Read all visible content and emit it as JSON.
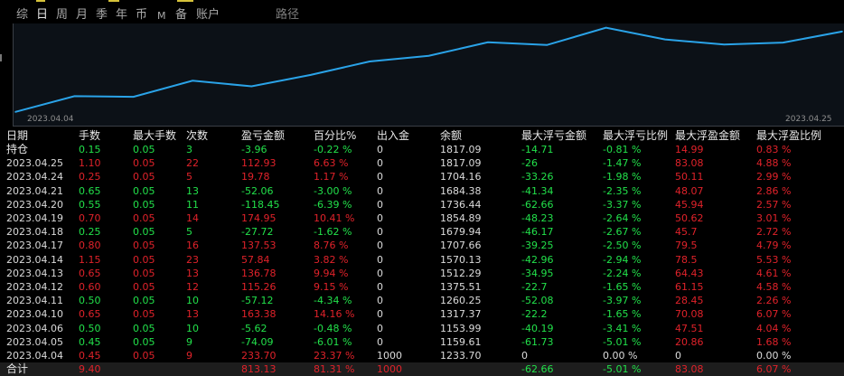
{
  "tabs": [
    {
      "label": "综",
      "active": false
    },
    {
      "label": "日",
      "active": true
    },
    {
      "label": "周",
      "active": false
    },
    {
      "label": "月",
      "active": false
    },
    {
      "label": "季",
      "active": false
    },
    {
      "label": "年",
      "active": false
    },
    {
      "label": "币",
      "active": false
    },
    {
      "label": "M",
      "active": false
    },
    {
      "label": "备",
      "active": false
    },
    {
      "label": "账户",
      "active": false
    }
  ],
  "path_label": "路径",
  "colors": {
    "line": "#2aa3e8",
    "positive": "#22e04a",
    "negative": "#e0222a",
    "text": "#dcdcdc"
  },
  "chart_data": {
    "type": "line",
    "x_start": "2023.04.04",
    "x_end": "2023.04.25",
    "x": [
      "2023.04.04",
      "2023.04.05",
      "2023.04.06",
      "2023.04.10",
      "2023.04.11",
      "2023.04.12",
      "2023.04.13",
      "2023.04.14",
      "2023.04.17",
      "2023.04.18",
      "2023.04.19",
      "2023.04.20",
      "2023.04.21",
      "2023.04.24",
      "2023.04.25"
    ],
    "values": [
      1000,
      1159.61,
      1153.99,
      1317.37,
      1260.25,
      1375.51,
      1512.29,
      1570.13,
      1707.66,
      1679.94,
      1854.89,
      1736.44,
      1684.38,
      1704.16,
      1817.09
    ],
    "ylim": [
      980,
      1880
    ]
  },
  "table": {
    "headers": [
      "日期",
      "手数",
      "最大手数",
      "次数",
      "盈亏金额",
      "百分比%",
      "出入金",
      "余额",
      "最大浮亏金额",
      "最大浮亏比例",
      "最大浮盈金额",
      "最大浮盈比例"
    ],
    "rows": [
      [
        "持仓",
        "0.15",
        "0.05",
        "3",
        "-3.96",
        "-0.22 %",
        "0",
        "1817.09",
        "-14.71",
        "-0.81 %",
        "14.99",
        "0.83 %"
      ],
      [
        "2023.04.25",
        "1.10",
        "0.05",
        "22",
        "112.93",
        "6.63 %",
        "0",
        "1817.09",
        "-26",
        "-1.47 %",
        "83.08",
        "4.88 %"
      ],
      [
        "2023.04.24",
        "0.25",
        "0.05",
        "5",
        "19.78",
        "1.17 %",
        "0",
        "1704.16",
        "-33.26",
        "-1.98 %",
        "50.11",
        "2.99 %"
      ],
      [
        "2023.04.21",
        "0.65",
        "0.05",
        "13",
        "-52.06",
        "-3.00 %",
        "0",
        "1684.38",
        "-41.34",
        "-2.35 %",
        "48.07",
        "2.86 %"
      ],
      [
        "2023.04.20",
        "0.55",
        "0.05",
        "11",
        "-118.45",
        "-6.39 %",
        "0",
        "1736.44",
        "-62.66",
        "-3.37 %",
        "45.94",
        "2.57 %"
      ],
      [
        "2023.04.19",
        "0.70",
        "0.05",
        "14",
        "174.95",
        "10.41 %",
        "0",
        "1854.89",
        "-48.23",
        "-2.64 %",
        "50.62",
        "3.01 %"
      ],
      [
        "2023.04.18",
        "0.25",
        "0.05",
        "5",
        "-27.72",
        "-1.62 %",
        "0",
        "1679.94",
        "-46.17",
        "-2.67 %",
        "45.7",
        "2.72 %"
      ],
      [
        "2023.04.17",
        "0.80",
        "0.05",
        "16",
        "137.53",
        "8.76 %",
        "0",
        "1707.66",
        "-39.25",
        "-2.50 %",
        "79.5",
        "4.79 %"
      ],
      [
        "2023.04.14",
        "1.15",
        "0.05",
        "23",
        "57.84",
        "3.82 %",
        "0",
        "1570.13",
        "-42.96",
        "-2.94 %",
        "78.5",
        "5.53 %"
      ],
      [
        "2023.04.13",
        "0.65",
        "0.05",
        "13",
        "136.78",
        "9.94 %",
        "0",
        "1512.29",
        "-34.95",
        "-2.24 %",
        "64.43",
        "4.61 %"
      ],
      [
        "2023.04.12",
        "0.60",
        "0.05",
        "12",
        "115.26",
        "9.15 %",
        "0",
        "1375.51",
        "-22.7",
        "-1.65 %",
        "61.15",
        "4.58 %"
      ],
      [
        "2023.04.11",
        "0.50",
        "0.05",
        "10",
        "-57.12",
        "-4.34 %",
        "0",
        "1260.25",
        "-52.08",
        "-3.97 %",
        "28.45",
        "2.26 %"
      ],
      [
        "2023.04.10",
        "0.65",
        "0.05",
        "13",
        "163.38",
        "14.16 %",
        "0",
        "1317.37",
        "-22.2",
        "-1.65 %",
        "70.08",
        "6.07 %"
      ],
      [
        "2023.04.06",
        "0.50",
        "0.05",
        "10",
        "-5.62",
        "-0.48 %",
        "0",
        "1153.99",
        "-40.19",
        "-3.41 %",
        "47.51",
        "4.04 %"
      ],
      [
        "2023.04.05",
        "0.45",
        "0.05",
        "9",
        "-74.09",
        "-6.01 %",
        "0",
        "1159.61",
        "-61.73",
        "-5.01 %",
        "20.86",
        "1.68 %"
      ],
      [
        "2023.04.04",
        "0.45",
        "0.05",
        "9",
        "233.70",
        "23.37 %",
        "1000",
        "1233.70",
        "0",
        "0.00 %",
        "0",
        "0.00 %"
      ],
      [
        "合计",
        "9.40",
        "",
        "",
        "813.13",
        "81.31 %",
        "1000",
        "",
        "-62.66",
        "-5.01 %",
        "83.08",
        "6.07 %"
      ]
    ],
    "row_colors": [
      "g",
      "r",
      "r",
      "g",
      "g",
      "r",
      "g",
      "r",
      "r",
      "r",
      "r",
      "g",
      "r",
      "g",
      "g",
      "r",
      "r"
    ]
  }
}
